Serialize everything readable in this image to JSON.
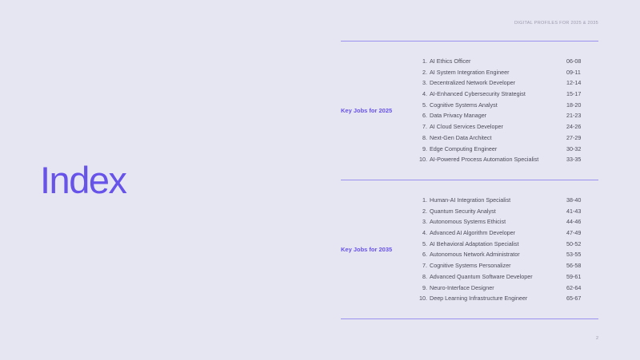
{
  "header": {
    "running_title": "DIGITAL PROFILES FOR 2025 & 2035"
  },
  "title": "Index",
  "sections": [
    {
      "label": "Key Jobs for 2025",
      "items": [
        {
          "num": "1.",
          "title": "AI Ethics Officer",
          "pages": "06-08"
        },
        {
          "num": "2.",
          "title": "AI System Integration Engineer",
          "pages": "09-11"
        },
        {
          "num": "3.",
          "title": "Decentralized Network Developer",
          "pages": "12-14"
        },
        {
          "num": "4.",
          "title": "AI-Enhanced Cybersecurity Strategist",
          "pages": "15-17"
        },
        {
          "num": "5.",
          "title": "Cognitive Systems Analyst",
          "pages": "18-20"
        },
        {
          "num": "6.",
          "title": "Data Privacy Manager",
          "pages": "21-23"
        },
        {
          "num": "7.",
          "title": "AI Cloud Services Developer",
          "pages": "24-26"
        },
        {
          "num": "8.",
          "title": "Next-Gen Data Architect",
          "pages": "27-29"
        },
        {
          "num": "9.",
          "title": "Edge Computing Engineer",
          "pages": "30-32"
        },
        {
          "num": "10.",
          "title": "AI-Powered Process Automation Specialist",
          "pages": "33-35"
        }
      ]
    },
    {
      "label": "Key Jobs for 2035",
      "items": [
        {
          "num": "1.",
          "title": "Human-AI Integration Specialist",
          "pages": "38-40"
        },
        {
          "num": "2.",
          "title": "Quantum Security Analyst",
          "pages": "41-43"
        },
        {
          "num": "3.",
          "title": "Autonomous Systems Ethicist",
          "pages": "44-46"
        },
        {
          "num": "4.",
          "title": "Advanced AI Algorithm Developer",
          "pages": "47-49"
        },
        {
          "num": "5.",
          "title": "AI Behavioral Adaptation Specialist",
          "pages": "50-52"
        },
        {
          "num": "6.",
          "title": "Autonomous Network Administrator",
          "pages": "53-55"
        },
        {
          "num": "7.",
          "title": "Cognitive Systems Personalizer",
          "pages": "56-58"
        },
        {
          "num": "8.",
          "title": "Advanced Quantum Software Developer",
          "pages": "59-61"
        },
        {
          "num": "9.",
          "title": "Neuro-Interface Designer",
          "pages": "62-64"
        },
        {
          "num": "10.",
          "title": "Deep Learning Infrastructure Engineer",
          "pages": "65-67"
        }
      ]
    }
  ],
  "footer": {
    "page_number": "2"
  },
  "colors": {
    "background": "#e6e6f2",
    "accent": "#6752ea",
    "rule": "#9a90ee",
    "text": "#4b4b5a",
    "muted": "#9a9aae"
  }
}
